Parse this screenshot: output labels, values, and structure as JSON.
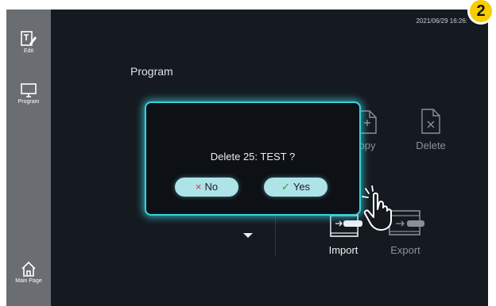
{
  "badge": "2",
  "timestamp": "2021/06/29 16:26:",
  "sidebar": {
    "items": [
      {
        "label": "Edit",
        "icon": "edit-icon"
      },
      {
        "label": "Program",
        "icon": "monitor-icon"
      },
      {
        "label": "Main Page",
        "icon": "home-icon"
      }
    ]
  },
  "main": {
    "title": "Program",
    "tiles": {
      "copy": "opy",
      "delete": "Delete",
      "import": "Import",
      "export": "Export"
    }
  },
  "dialog": {
    "message": "Delete 25: TEST ?",
    "no_label": "No",
    "yes_label": "Yes",
    "no_mark": "×",
    "yes_mark": "✓"
  },
  "colors": {
    "accent": "#35d2dc",
    "badge": "#f7cc00",
    "background": "#151a20",
    "sidebar": "#6a6d71"
  }
}
